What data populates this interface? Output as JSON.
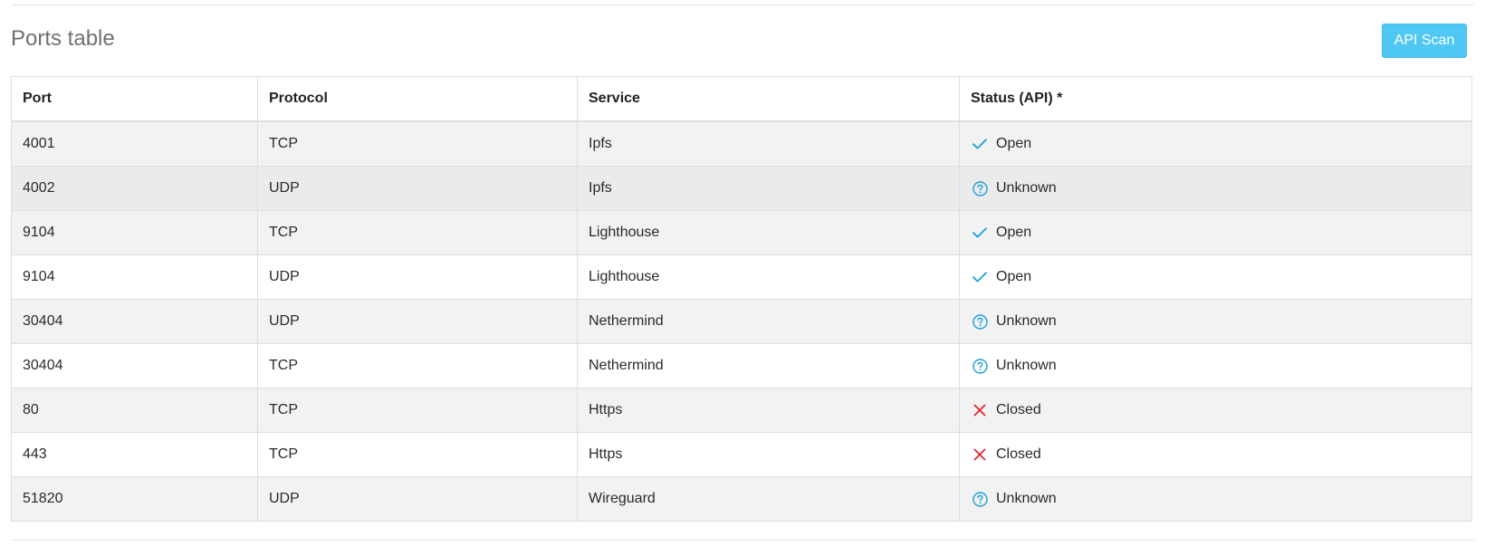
{
  "header": {
    "title": "Ports table",
    "scan_button_label": "API Scan"
  },
  "table": {
    "columns": [
      "Port",
      "Protocol",
      "Service",
      "Status (API) *"
    ],
    "rows": [
      {
        "port": "4001",
        "protocol": "TCP",
        "service": "Ipfs",
        "status": "Open",
        "status_icon": "check-icon"
      },
      {
        "port": "4002",
        "protocol": "UDP",
        "service": "Ipfs",
        "status": "Unknown",
        "status_icon": "question-circle-icon"
      },
      {
        "port": "9104",
        "protocol": "TCP",
        "service": "Lighthouse",
        "status": "Open",
        "status_icon": "check-icon"
      },
      {
        "port": "9104",
        "protocol": "UDP",
        "service": "Lighthouse",
        "status": "Open",
        "status_icon": "check-icon"
      },
      {
        "port": "30404",
        "protocol": "UDP",
        "service": "Nethermind",
        "status": "Unknown",
        "status_icon": "question-circle-icon"
      },
      {
        "port": "30404",
        "protocol": "TCP",
        "service": "Nethermind",
        "status": "Unknown",
        "status_icon": "question-circle-icon"
      },
      {
        "port": "80",
        "protocol": "TCP",
        "service": "Https",
        "status": "Closed",
        "status_icon": "close-icon"
      },
      {
        "port": "443",
        "protocol": "TCP",
        "service": "Https",
        "status": "Closed",
        "status_icon": "close-icon"
      },
      {
        "port": "51820",
        "protocol": "UDP",
        "service": "Wireguard",
        "status": "Unknown",
        "status_icon": "question-circle-icon"
      }
    ]
  },
  "colors": {
    "accent": "#4fc8f4",
    "status_open": "#1a9fd9",
    "status_unknown": "#1a9fd9",
    "status_closed": "#e0262b"
  }
}
